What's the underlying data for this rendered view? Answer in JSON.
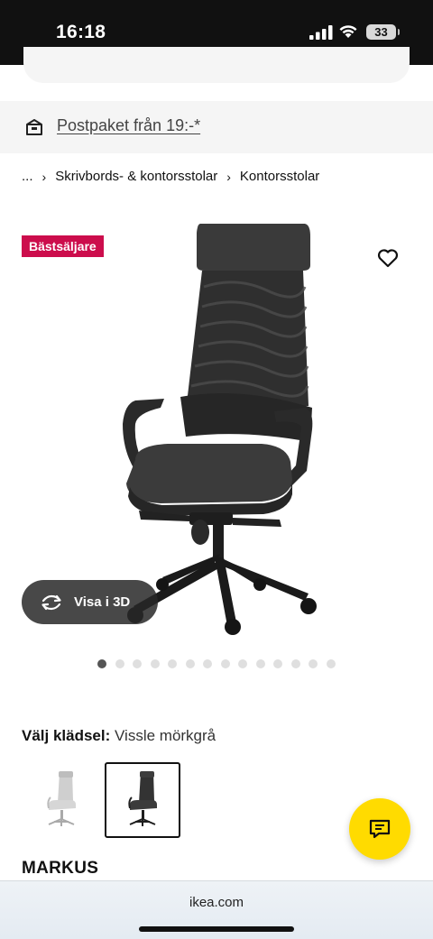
{
  "status_bar": {
    "time": "16:18",
    "battery": "33",
    "icons": [
      "signal-icon",
      "wifi-icon",
      "battery-icon"
    ]
  },
  "delivery": {
    "icon": "package-icon",
    "link_text": "Postpaket från 19:-*"
  },
  "breadcrumb": {
    "ellipsis": "...",
    "separator": "›",
    "items": [
      "Skrivbords- & kontorsstolar",
      "Kontorsstolar"
    ]
  },
  "gallery": {
    "badge": "Bästsäljare",
    "favorite_icon": "heart-outline-icon",
    "view3d_label": "Visa i 3D",
    "view3d_icon": "rotate-3d-icon",
    "dot_count": 14,
    "active_dot": 0
  },
  "upholstery": {
    "label": "Välj klädsel:",
    "value": "Vissle mörkgrå",
    "swatches": [
      "light-grey-chair",
      "dark-grey-chair"
    ],
    "selected_swatch": 1
  },
  "product": {
    "name": "MARKUS"
  },
  "chat": {
    "icon": "chat-icon"
  },
  "browser": {
    "url": "ikea.com"
  },
  "colors": {
    "badge": "#cc0d4c",
    "chat_button": "#ffdb00",
    "banner_bg": "#f5f5f5"
  }
}
